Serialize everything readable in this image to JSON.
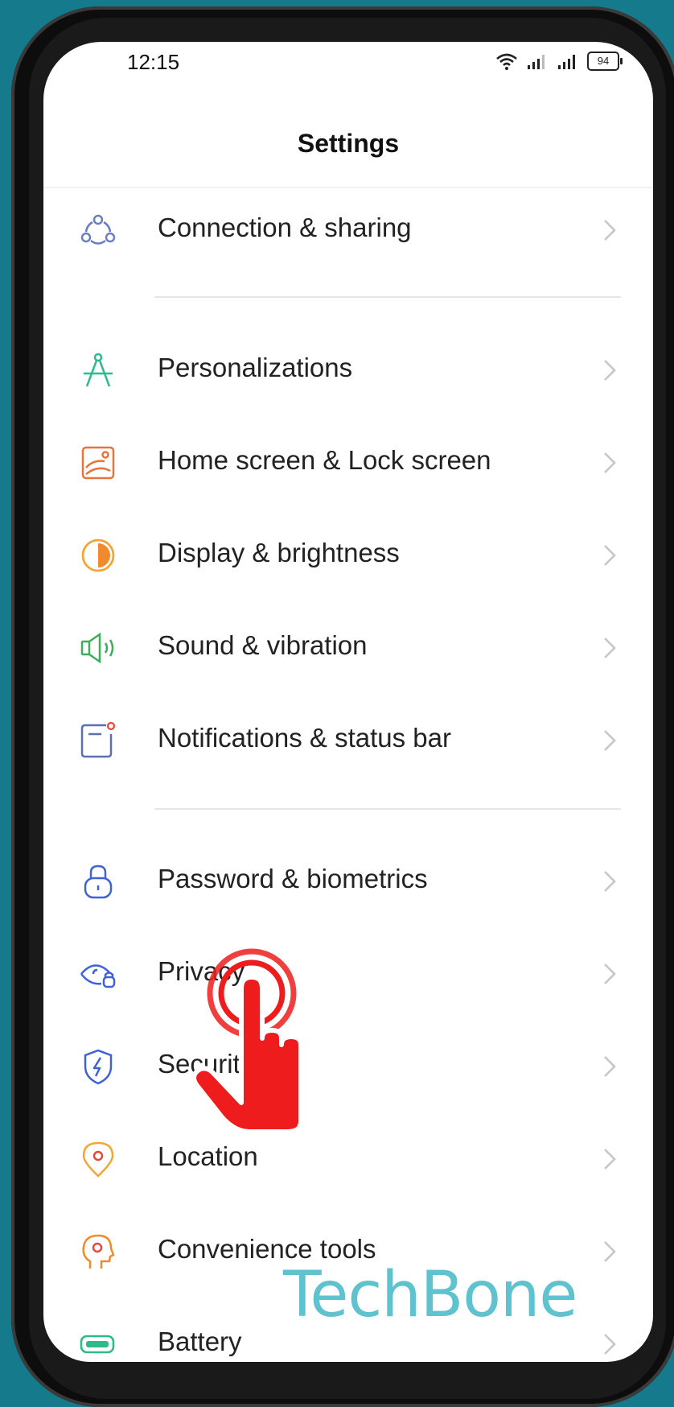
{
  "status": {
    "time": "12:15",
    "battery": "94"
  },
  "header": {
    "title": "Settings"
  },
  "items": [
    {
      "label": "Connection & sharing",
      "icon": "connection-icon"
    },
    {
      "label": "Personalizations",
      "icon": "compass-icon"
    },
    {
      "label": "Home screen & Lock screen",
      "icon": "wallpaper-icon"
    },
    {
      "label": "Display & brightness",
      "icon": "brightness-icon"
    },
    {
      "label": "Sound & vibration",
      "icon": "speaker-icon"
    },
    {
      "label": "Notifications & status bar",
      "icon": "notification-icon"
    },
    {
      "label": "Password & biometrics",
      "icon": "lock-icon"
    },
    {
      "label": "Privacy",
      "icon": "privacy-eye-icon"
    },
    {
      "label": "Security",
      "icon": "shield-icon"
    },
    {
      "label": "Location",
      "icon": "location-pin-icon"
    },
    {
      "label": "Convenience tools",
      "icon": "head-gear-icon"
    },
    {
      "label": "Battery",
      "icon": "battery-icon"
    }
  ],
  "watermark": "TechBone",
  "colors": {
    "background": "#157b8c",
    "connection": "#6b7fbf",
    "personalizations": "#2dbb8a",
    "home_screen": "#e8733b",
    "display": "#f4a533",
    "sound": "#3fae5a",
    "notifications": "#5b6fb3",
    "password": "#3f62d6",
    "privacy": "#3f62d6",
    "security": "#3f62d6",
    "location": "#f4a533",
    "convenience": "#f08a2c",
    "battery": "#2dbb8a",
    "tap_hand": "#ee1c1c"
  }
}
